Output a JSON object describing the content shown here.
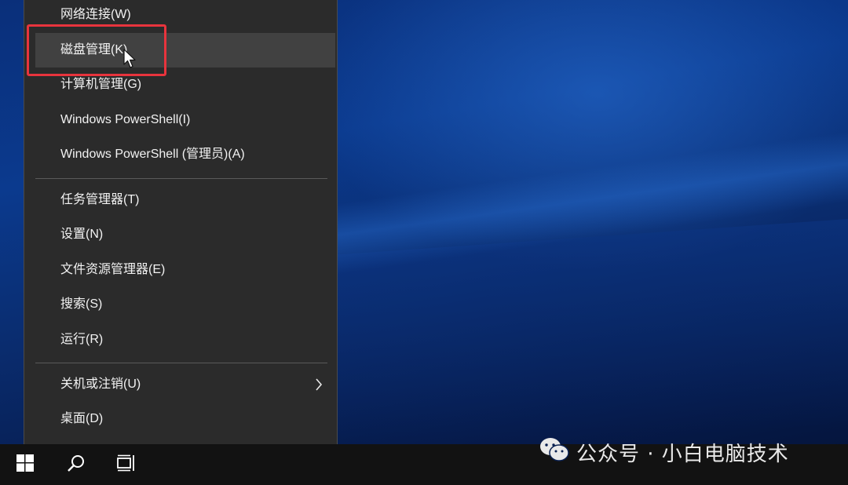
{
  "menu": {
    "items": [
      {
        "label": "网络连接(W)"
      },
      {
        "label": "磁盘管理(K)"
      },
      {
        "label": "计算机管理(G)"
      },
      {
        "label": "Windows PowerShell(I)"
      },
      {
        "label": "Windows PowerShell (管理员)(A)"
      },
      {
        "label": "任务管理器(T)"
      },
      {
        "label": "设置(N)"
      },
      {
        "label": "文件资源管理器(E)"
      },
      {
        "label": "搜索(S)"
      },
      {
        "label": "运行(R)"
      },
      {
        "label": "关机或注销(U)"
      },
      {
        "label": "桌面(D)"
      }
    ],
    "hovered_item": "磁盘管理(K)",
    "submenu_icon": "chevron-right-icon"
  },
  "annotation": {
    "highlight_color": "#e8343d"
  },
  "taskbar": {
    "icons": [
      "windows-logo-icon",
      "search-icon",
      "task-view-icon"
    ]
  },
  "watermark": {
    "icon": "wechat-icon",
    "text": "公众号 · 小白电脑技术"
  },
  "colors": {
    "menu_bg": "#2b2b2b",
    "menu_hover": "#414141",
    "text": "#f2f2f2",
    "taskbar_bg": "#121212"
  }
}
